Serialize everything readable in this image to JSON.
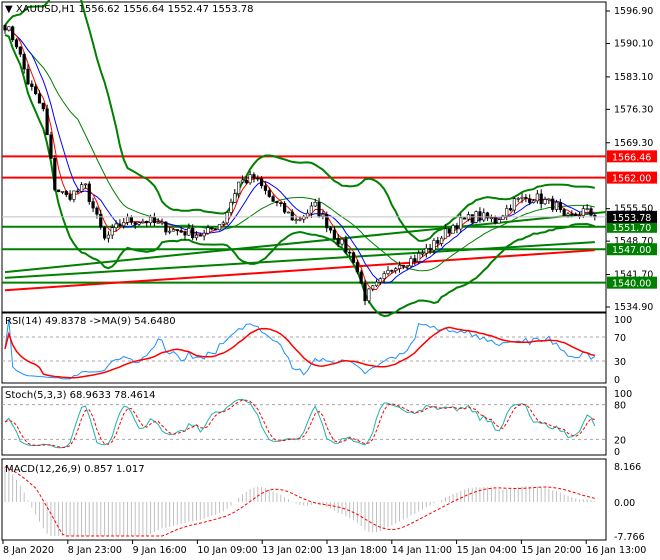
{
  "header": {
    "symbol": "XAUUSD,H1",
    "ohlc": "1556.62 1556.64 1552.47 1553.78"
  },
  "colors": {
    "bull": "#008000",
    "red": "#ff0000",
    "blue": "#0000ff",
    "rsi": "#1e90ff",
    "stoch": "#20b2aa",
    "hist": "#c0c0c0"
  },
  "chart_data": {
    "type": "line",
    "title": "XAUUSD,H1",
    "ylim": [
      1534.9,
      1596.9
    ],
    "price_ticks": [
      "1596.90",
      "1590.10",
      "1583.10",
      "1576.30",
      "1569.30",
      "1555.50",
      "1548.70",
      "1541.70",
      "1534.90"
    ],
    "levels": [
      {
        "price": 1566.46,
        "label": "1566.46",
        "color": "#ff0000"
      },
      {
        "price": 1562.0,
        "label": "1562.00",
        "color": "#ff0000"
      },
      {
        "price": 1551.7,
        "label": "1551.70",
        "color": "#008000"
      },
      {
        "price": 1547.0,
        "label": "1547.00",
        "color": "#008000"
      },
      {
        "price": 1540.0,
        "label": "1540.00",
        "color": "#008000"
      }
    ],
    "current_price": {
      "price": 1553.78,
      "label": "1553.78"
    },
    "close_keypoints": [
      [
        0,
        1594
      ],
      [
        3,
        1590
      ],
      [
        6,
        1582
      ],
      [
        10,
        1576
      ],
      [
        13,
        1560
      ],
      [
        16,
        1558
      ],
      [
        21,
        1560
      ],
      [
        26,
        1549
      ],
      [
        31,
        1553
      ],
      [
        37,
        1553
      ],
      [
        44,
        1551
      ],
      [
        52,
        1550
      ],
      [
        57,
        1553
      ],
      [
        61,
        1561
      ],
      [
        65,
        1562
      ],
      [
        70,
        1557
      ],
      [
        76,
        1553
      ],
      [
        81,
        1556
      ],
      [
        86,
        1550
      ],
      [
        91,
        1545
      ],
      [
        94,
        1537
      ],
      [
        98,
        1540
      ],
      [
        102,
        1544
      ],
      [
        107,
        1545
      ],
      [
        112,
        1548
      ],
      [
        117,
        1552
      ],
      [
        123,
        1554
      ],
      [
        128,
        1553
      ],
      [
        133,
        1557
      ],
      [
        138,
        1558
      ],
      [
        144,
        1556
      ],
      [
        146,
        1553
      ],
      [
        151,
        1555
      ],
      [
        154,
        1554
      ]
    ],
    "ma_long_keypoints": [
      [
        0,
        1538.4
      ],
      [
        154,
        1546.8
      ]
    ],
    "trendlines": [
      [
        [
          0,
          1542.2
        ],
        [
          157,
          1554.8
        ]
      ],
      [
        [
          0,
          1541
        ],
        [
          154,
          1548.5
        ]
      ]
    ],
    "time_labels": [
      "8 Jan 2020",
      "8 Jan 23:00",
      "9 Jan 16:00",
      "10 Jan 09:00",
      "13 Jan 02:00",
      "13 Jan 18:00",
      "14 Jan 11:00",
      "15 Jan 04:00",
      "15 Jan 20:00",
      "16 Jan 13:00"
    ],
    "rsi": {
      "label": "RSI(14) 49.8378  ->MA(9) 54.6480",
      "ticks": [
        "100",
        "70",
        "30",
        "0"
      ]
    },
    "stoch": {
      "label": "Stoch(5,3,3) 68.9633 78.4614",
      "ticks": [
        "100",
        "80",
        "20",
        "0"
      ]
    },
    "macd": {
      "label": "MACD(12,26,9) 0.857 1.017",
      "ticks": [
        "8.166",
        "0.00",
        "-7.766"
      ],
      "range": [
        -7.766,
        8.166
      ]
    }
  }
}
